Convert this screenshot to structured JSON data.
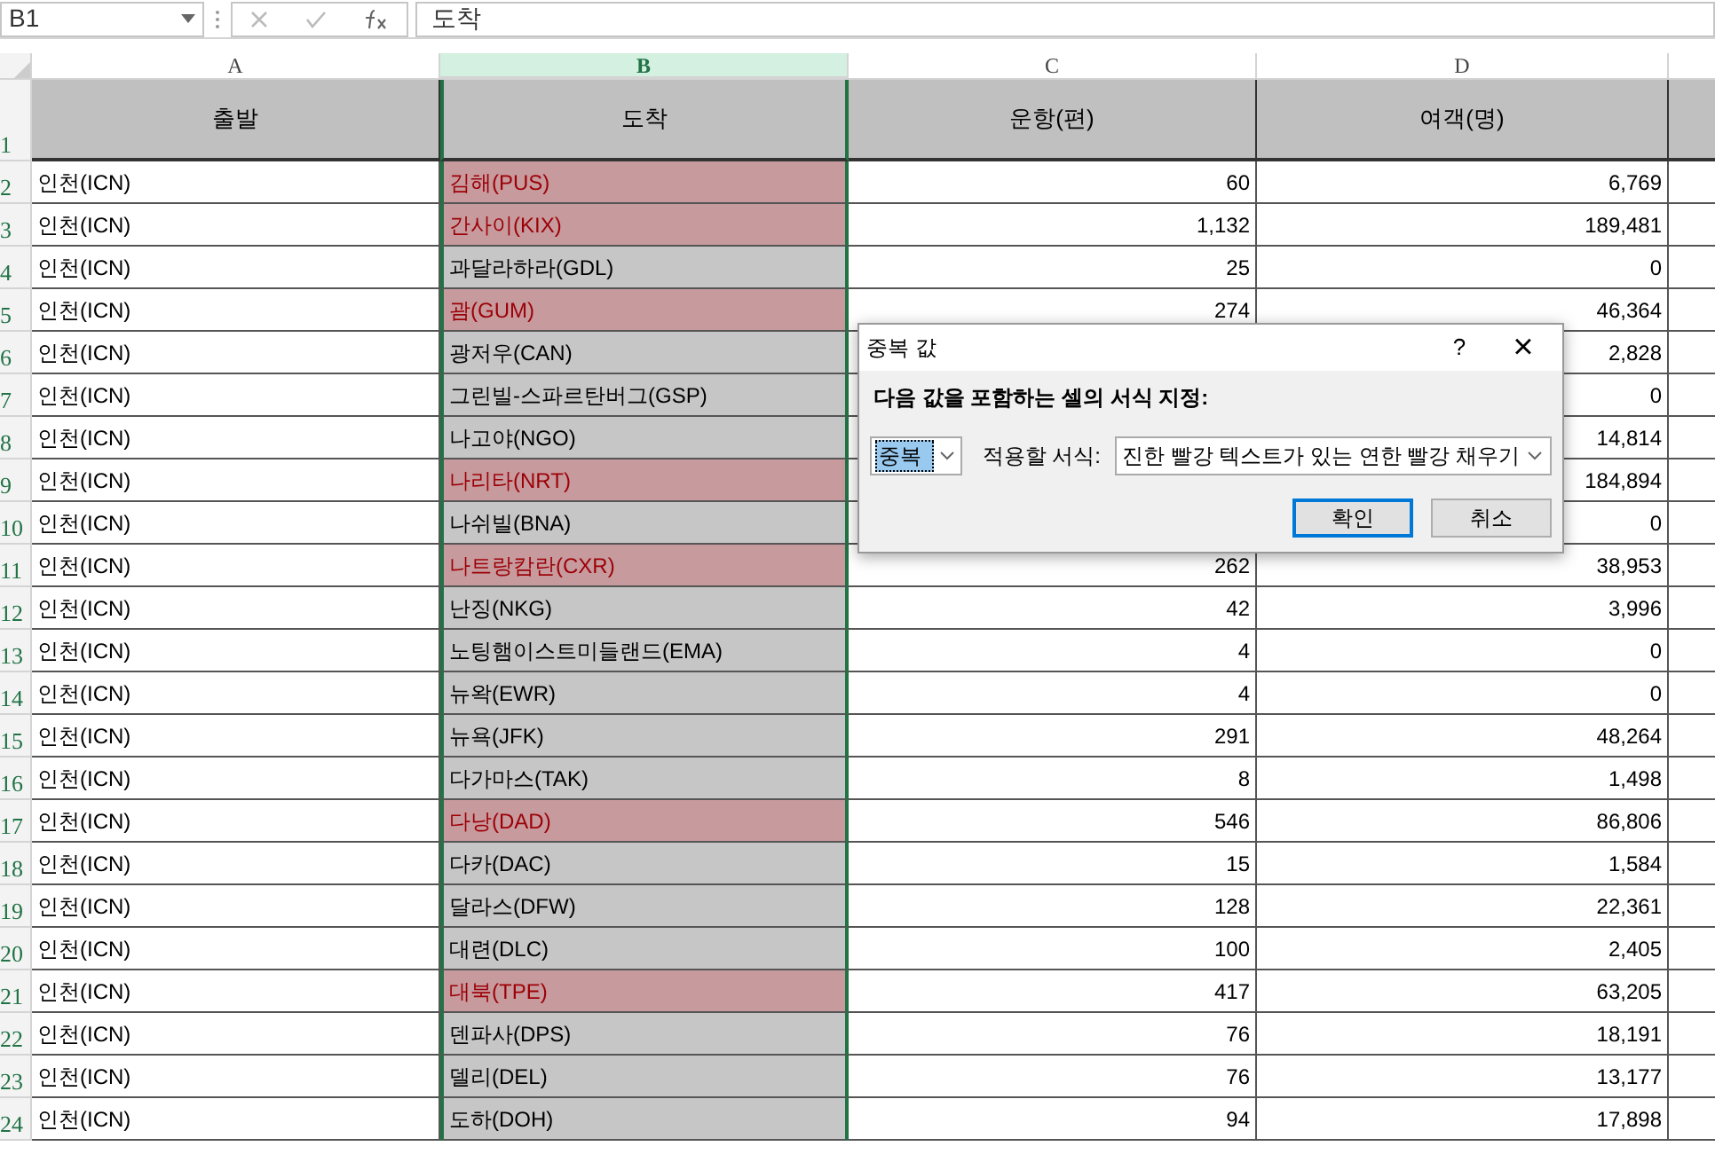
{
  "formula_bar": {
    "name_box": "B1",
    "formula": "도착"
  },
  "columns": [
    {
      "letter": "A",
      "selected": false
    },
    {
      "letter": "B",
      "selected": true
    },
    {
      "letter": "C",
      "selected": false
    },
    {
      "letter": "D",
      "selected": false
    }
  ],
  "header_row": {
    "number": "1",
    "cells": [
      "출발",
      "도착",
      "운항(편)",
      "여객(명)"
    ]
  },
  "rows": [
    {
      "number": "2",
      "origin": "인천(ICN)",
      "destination": "김해(PUS)",
      "duplicate": true,
      "flights": "60",
      "passengers": "6,769"
    },
    {
      "number": "3",
      "origin": "인천(ICN)",
      "destination": "간사이(KIX)",
      "duplicate": true,
      "flights": "1,132",
      "passengers": "189,481"
    },
    {
      "number": "4",
      "origin": "인천(ICN)",
      "destination": "과달라하라(GDL)",
      "duplicate": false,
      "flights": "25",
      "passengers": "0"
    },
    {
      "number": "5",
      "origin": "인천(ICN)",
      "destination": "괌(GUM)",
      "duplicate": true,
      "flights": "274",
      "passengers": "46,364"
    },
    {
      "number": "6",
      "origin": "인천(ICN)",
      "destination": "광저우(CAN)",
      "duplicate": false,
      "passengers": "2,828"
    },
    {
      "number": "7",
      "origin": "인천(ICN)",
      "destination": "그린빌-스파르탄버그(GSP)",
      "duplicate": false,
      "passengers": "0"
    },
    {
      "number": "8",
      "origin": "인천(ICN)",
      "destination": "나고야(NGO)",
      "duplicate": false,
      "passengers": "14,814"
    },
    {
      "number": "9",
      "origin": "인천(ICN)",
      "destination": "나리타(NRT)",
      "duplicate": true,
      "passengers": "184,894"
    },
    {
      "number": "10",
      "origin": "인천(ICN)",
      "destination": "나쉬빌(BNA)",
      "duplicate": false,
      "passengers": "0"
    },
    {
      "number": "11",
      "origin": "인천(ICN)",
      "destination": "나트랑캄란(CXR)",
      "duplicate": true,
      "flights": "262",
      "passengers": "38,953"
    },
    {
      "number": "12",
      "origin": "인천(ICN)",
      "destination": "난징(NKG)",
      "duplicate": false,
      "flights": "42",
      "passengers": "3,996"
    },
    {
      "number": "13",
      "origin": "인천(ICN)",
      "destination": "노팅햄이스트미들랜드(EMA)",
      "duplicate": false,
      "flights": "4",
      "passengers": "0"
    },
    {
      "number": "14",
      "origin": "인천(ICN)",
      "destination": "뉴왁(EWR)",
      "duplicate": false,
      "flights": "4",
      "passengers": "0"
    },
    {
      "number": "15",
      "origin": "인천(ICN)",
      "destination": "뉴욕(JFK)",
      "duplicate": false,
      "flights": "291",
      "passengers": "48,264"
    },
    {
      "number": "16",
      "origin": "인천(ICN)",
      "destination": "다가마스(TAK)",
      "duplicate": false,
      "flights": "8",
      "passengers": "1,498"
    },
    {
      "number": "17",
      "origin": "인천(ICN)",
      "destination": "다낭(DAD)",
      "duplicate": true,
      "flights": "546",
      "passengers": "86,806"
    },
    {
      "number": "18",
      "origin": "인천(ICN)",
      "destination": "다카(DAC)",
      "duplicate": false,
      "flights": "15",
      "passengers": "1,584"
    },
    {
      "number": "19",
      "origin": "인천(ICN)",
      "destination": "달라스(DFW)",
      "duplicate": false,
      "flights": "128",
      "passengers": "22,361"
    },
    {
      "number": "20",
      "origin": "인천(ICN)",
      "destination": "대련(DLC)",
      "duplicate": false,
      "flights": "100",
      "passengers": "2,405"
    },
    {
      "number": "21",
      "origin": "인천(ICN)",
      "destination": "대북(TPE)",
      "duplicate": true,
      "flights": "417",
      "passengers": "63,205"
    },
    {
      "number": "22",
      "origin": "인천(ICN)",
      "destination": "덴파사(DPS)",
      "duplicate": false,
      "flights": "76",
      "passengers": "18,191"
    },
    {
      "number": "23",
      "origin": "인천(ICN)",
      "destination": "델리(DEL)",
      "duplicate": false,
      "flights": "76",
      "passengers": "13,177"
    },
    {
      "number": "24",
      "origin": "인천(ICN)",
      "destination": "도하(DOH)",
      "duplicate": false,
      "flights": "94",
      "passengers": "17,898"
    }
  ],
  "dialog": {
    "title": "중복 값",
    "help": "?",
    "close": "×",
    "instruction": "다음 값을 포함하는 셀의 서식 지정:",
    "rule_value": "중복",
    "format_label": "적용할 서식:",
    "format_value": "진한 빨강 텍스트가 있는 연한 빨강 채우기",
    "buttons": [
      {
        "label": "확인",
        "default": true
      },
      {
        "label": "취소",
        "default": false
      }
    ]
  }
}
